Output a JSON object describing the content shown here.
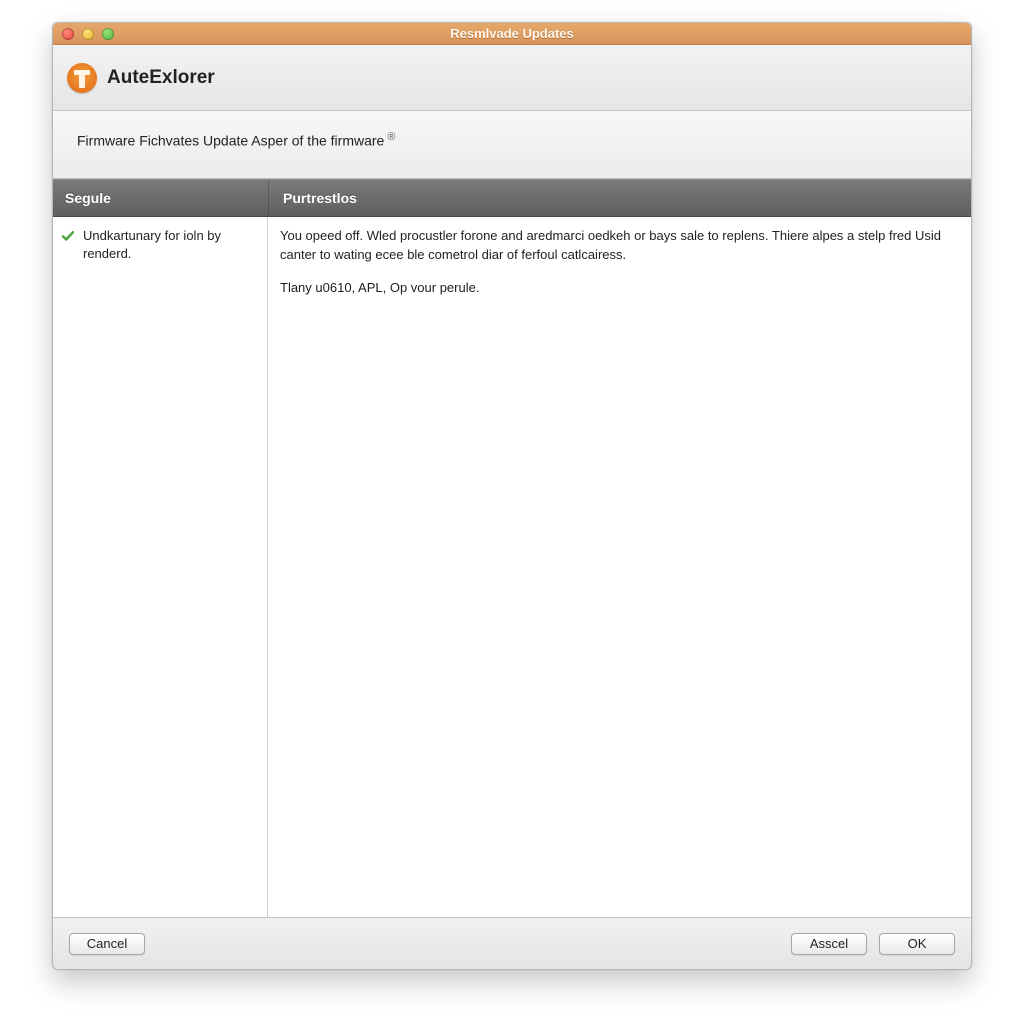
{
  "window_title": "Resmlvade Updates",
  "brand_name": "AuteExlorer",
  "subheading": "Firmware Fichvates Update Asper of the firmware",
  "columns": {
    "left": "Segule",
    "right": "Purtrestlos"
  },
  "module_item": "Undkartunary for ioln by renderd.",
  "description": {
    "p1": "You opeed off. Wled procustler forone and aredmarci oedkeh or bays sale to replens. Thiere alpes a stelp fred Usid canter to wating ecee ble cometrol diar of ferfoul catlcairess.",
    "p2": "Tlany u0610, APL, Op vour perule."
  },
  "buttons": {
    "cancel": "Cancel",
    "asscel": "Asscel",
    "ok": "OK"
  }
}
